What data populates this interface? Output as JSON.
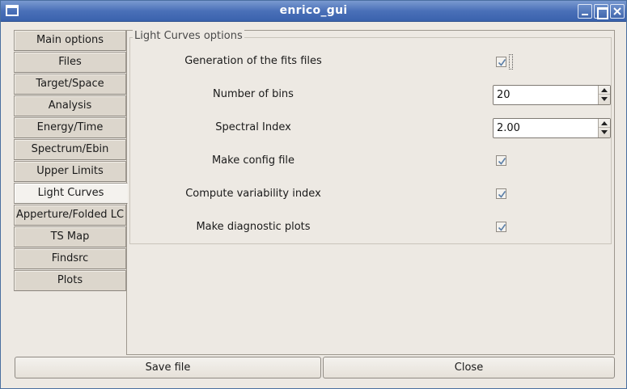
{
  "window": {
    "title": "enrico_gui"
  },
  "tabs": [
    {
      "label": "Main options"
    },
    {
      "label": "Files"
    },
    {
      "label": "Target/Space"
    },
    {
      "label": "Analysis"
    },
    {
      "label": "Energy/Time"
    },
    {
      "label": "Spectrum/Ebin"
    },
    {
      "label": "Upper Limits"
    },
    {
      "label": "Light Curves",
      "active": true
    },
    {
      "label": "Apperture/Folded LC"
    },
    {
      "label": "TS Map"
    },
    {
      "label": "Findsrc"
    },
    {
      "label": "Plots"
    }
  ],
  "panel": {
    "title": "Light Curves options",
    "rows": [
      {
        "label": "Generation of the fits files",
        "type": "checkbox",
        "checked": true
      },
      {
        "label": "Number of bins",
        "type": "spinbox",
        "value": "20"
      },
      {
        "label": "Spectral Index",
        "type": "spinbox",
        "value": "2.00"
      },
      {
        "label": "Make config file",
        "type": "checkbox",
        "checked": true
      },
      {
        "label": "Compute variability index",
        "type": "checkbox",
        "checked": true
      },
      {
        "label": "Make diagnostic plots",
        "type": "checkbox",
        "checked": true
      }
    ]
  },
  "buttons": {
    "save": "Save file",
    "close": "Close"
  },
  "colors": {
    "titlebar": "#4a70b8",
    "background": "#ede9e3",
    "tab": "#dcd6cc",
    "active_tab": "#f4f2ee"
  }
}
